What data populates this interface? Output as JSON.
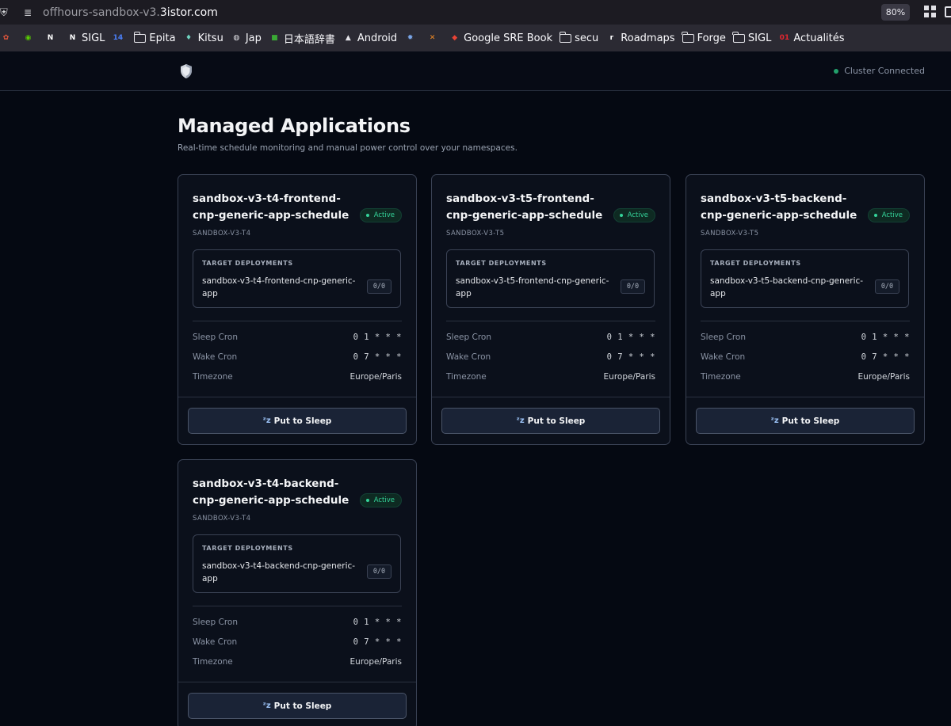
{
  "browser": {
    "url_prefix": "offhours-sandbox-v3.",
    "url_domain": "3istor.com",
    "zoom": "80%",
    "bookmarks": [
      {
        "label": "",
        "icon": "flower-icon",
        "type": "icon",
        "color": "#e0553b"
      },
      {
        "label": "",
        "icon": "owl-icon",
        "type": "icon",
        "color": "#58cc02"
      },
      {
        "label": "",
        "icon": "notion-icon",
        "type": "icon",
        "color": "#ffffff"
      },
      {
        "label": "SIGL",
        "icon": "notion-icon",
        "type": "icon",
        "color": "#ffffff"
      },
      {
        "label": "",
        "icon": "calendar-icon",
        "type": "icon",
        "color": "#4a7ff7"
      },
      {
        "label": "Epita",
        "icon": "folder-icon",
        "type": "folder"
      },
      {
        "label": "Kitsu",
        "icon": "kitsu-icon",
        "type": "icon",
        "color": "#6fd3c0"
      },
      {
        "label": "Jap",
        "icon": "globe-icon",
        "type": "icon",
        "color": "#e5e5ea"
      },
      {
        "label": "日本語辞書",
        "icon": "dictionary-icon",
        "type": "icon",
        "color": "#3aa935"
      },
      {
        "label": "Android",
        "icon": "android-icon",
        "type": "icon",
        "color": "#e5e5ea"
      },
      {
        "label": "",
        "icon": "gear-icon",
        "type": "icon",
        "color": "#7aa6e8"
      },
      {
        "label": "",
        "icon": "x-icon",
        "type": "icon",
        "color": "#f08a24"
      },
      {
        "label": "Google SRE Book",
        "icon": "google-icon",
        "type": "icon",
        "color": "#ea4335"
      },
      {
        "label": "secu",
        "icon": "folder-icon",
        "type": "folder"
      },
      {
        "label": "Roadmaps",
        "icon": "roadmap-icon",
        "type": "icon",
        "color": "#ffffff"
      },
      {
        "label": "Forge",
        "icon": "folder-icon",
        "type": "folder"
      },
      {
        "label": "SIGL",
        "icon": "folder-icon",
        "type": "folder"
      },
      {
        "label": "Actualités",
        "icon": "news-icon",
        "type": "icon",
        "color": "#e0262f"
      }
    ]
  },
  "header": {
    "logo_icon": "shield-icon",
    "status": "Cluster Connected",
    "status_color": "#22a06b"
  },
  "main": {
    "title": "Managed Applications",
    "subtitle": "Real-time schedule monitoring and manual power control over your namespaces."
  },
  "labels": {
    "target_deployments": "TARGET DEPLOYMENTS",
    "sleep_cron": "Sleep Cron",
    "wake_cron": "Wake Cron",
    "timezone": "Timezone",
    "put_to_sleep": "Put to Sleep"
  },
  "cards": [
    {
      "name": "sandbox-v3-t4-frontend-cnp-generic-app-schedule",
      "status": "Active",
      "namespace": "SANDBOX-V3-T4",
      "deployment": "sandbox-v3-t4-frontend-cnp-generic-app",
      "replicas": "0/0",
      "sleep_cron": "0 1 * * *",
      "wake_cron": "0 7 * * *",
      "timezone": "Europe/Paris",
      "button": "Put to Sleep"
    },
    {
      "name": "sandbox-v3-t5-frontend-cnp-generic-app-schedule",
      "status": "Active",
      "namespace": "SANDBOX-V3-T5",
      "deployment": "sandbox-v3-t5-frontend-cnp-generic-app",
      "replicas": "0/0",
      "sleep_cron": "0 1 * * *",
      "wake_cron": "0 7 * * *",
      "timezone": "Europe/Paris",
      "button": "Put to Sleep"
    },
    {
      "name": "sandbox-v3-t5-backend-cnp-generic-app-schedule",
      "status": "Active",
      "namespace": "SANDBOX-V3-T5",
      "deployment": "sandbox-v3-t5-backend-cnp-generic-app",
      "replicas": "0/0",
      "sleep_cron": "0 1 * * *",
      "wake_cron": "0 7 * * *",
      "timezone": "Europe/Paris",
      "button": "Put to Sleep"
    },
    {
      "name": "sandbox-v3-t4-backend-cnp-generic-app-schedule",
      "status": "Active",
      "namespace": "SANDBOX-V3-T4",
      "deployment": "sandbox-v3-t4-backend-cnp-generic-app",
      "replicas": "0/0",
      "sleep_cron": "0 1 * * *",
      "wake_cron": "0 7 * * *",
      "timezone": "Europe/Paris",
      "button": "Put to Sleep"
    }
  ]
}
